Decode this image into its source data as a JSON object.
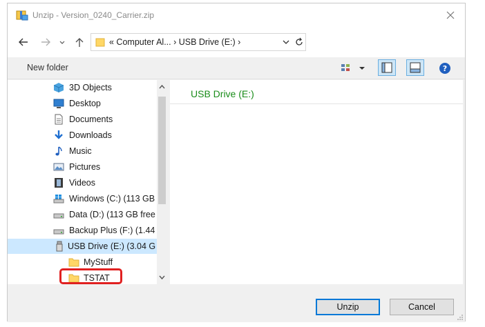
{
  "window": {
    "title": "Unzip - Version_0240_Carrier.zip",
    "title_icon": "zip-archive-icon",
    "close_icon": "close-icon"
  },
  "nav": {
    "back_icon": "arrow-left-icon",
    "forward_icon": "arrow-right-icon",
    "recent_icon": "chevron-down-icon",
    "up_icon": "arrow-up-icon",
    "address": "«  Computer Al...  ›  USB Drive (E:)  ›",
    "refresh_icon": "refresh-icon"
  },
  "toolbar": {
    "new_folder": "New folder",
    "view_icon": "view-options-icon",
    "navigation_pane_icon": "navigation-pane-icon",
    "preview_pane_icon": "preview-pane-icon",
    "help_icon": "help-icon"
  },
  "tree": {
    "items": [
      {
        "label": "3D Objects",
        "icon": "cube-3d-icon"
      },
      {
        "label": "Desktop",
        "icon": "desktop-icon"
      },
      {
        "label": "Documents",
        "icon": "document-icon"
      },
      {
        "label": "Downloads",
        "icon": "download-arrow-icon"
      },
      {
        "label": "Music",
        "icon": "music-note-icon"
      },
      {
        "label": "Pictures",
        "icon": "picture-icon"
      },
      {
        "label": "Videos",
        "icon": "film-icon"
      },
      {
        "label": "Windows (C:) (113 GB",
        "icon": "windows-drive-icon"
      },
      {
        "label": "Data (D:) (113 GB free",
        "icon": "drive-icon"
      },
      {
        "label": "Backup Plus (F:) (1.44",
        "icon": "drive-icon"
      },
      {
        "label": "USB Drive (E:) (3.04 G",
        "icon": "usb-drive-icon",
        "selected": true
      },
      {
        "label": "MyStuff",
        "icon": "folder-icon"
      },
      {
        "label": "TSTAT",
        "icon": "folder-icon"
      }
    ]
  },
  "content": {
    "heading": "USB Drive (E:)"
  },
  "buttons": {
    "unzip": "Unzip",
    "cancel": "Cancel"
  },
  "colors": {
    "heading_green": "#1a8c1a",
    "selection": "#cce8ff",
    "highlight_red": "#e02020",
    "folder_yellow": "#ffd766"
  }
}
